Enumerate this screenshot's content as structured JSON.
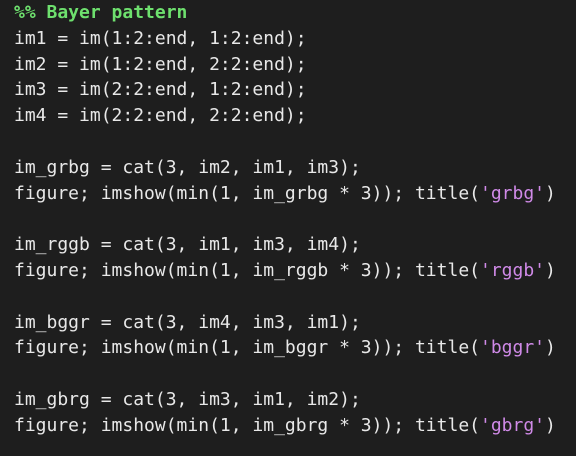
{
  "colors": {
    "background": "#1e1e1e",
    "text": "#e8e8e8",
    "comment": "#6ee06e",
    "string": "#d08ae8"
  },
  "code": {
    "comment": "%% Bayer pattern",
    "lines": [
      "im1 = im(1:2:end, 1:2:end);",
      "im2 = im(1:2:end, 2:2:end);",
      "im3 = im(2:2:end, 1:2:end);",
      "im4 = im(2:2:end, 2:2:end);",
      "",
      "im_grbg = cat(3, im2, im1, im3);",
      {
        "pre": "figure; imshow(min(1, im_grbg * 3)); title(",
        "str": "'grbg'",
        "post": ")"
      },
      "",
      "im_rggb = cat(3, im1, im3, im4);",
      {
        "pre": "figure; imshow(min(1, im_rggb * 3)); title(",
        "str": "'rggb'",
        "post": ")"
      },
      "",
      "im_bggr = cat(3, im4, im3, im1);",
      {
        "pre": "figure; imshow(min(1, im_bggr * 3)); title(",
        "str": "'bggr'",
        "post": ")"
      },
      "",
      "im_gbrg = cat(3, im3, im1, im2);",
      {
        "pre": "figure; imshow(min(1, im_gbrg * 3)); title(",
        "str": "'gbrg'",
        "post": ")"
      }
    ]
  }
}
